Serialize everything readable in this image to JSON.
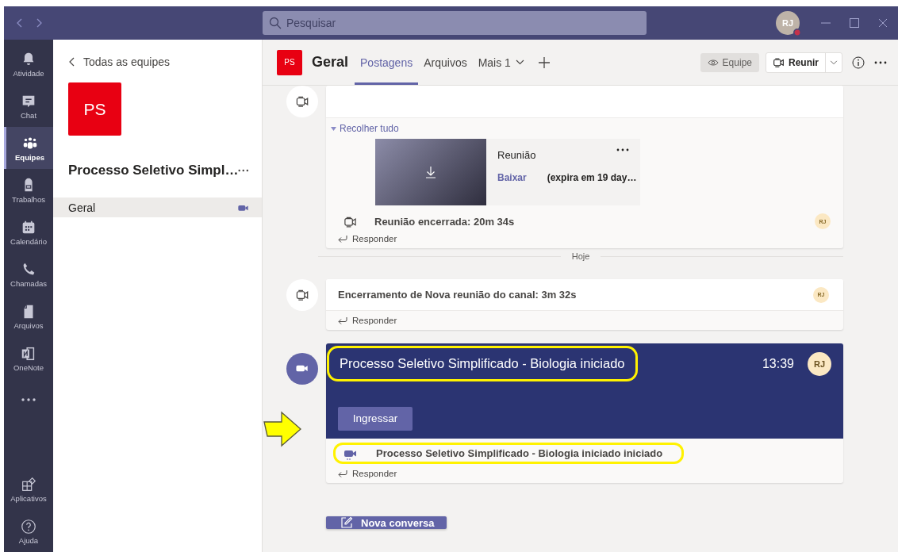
{
  "window": {
    "search_placeholder": "Pesquisar",
    "user_initials": "RJ"
  },
  "rail": [
    {
      "label": "Atividade",
      "kind": "bell",
      "selected": false
    },
    {
      "label": "Chat",
      "kind": "chat",
      "selected": false
    },
    {
      "label": "Equipes",
      "kind": "teams",
      "selected": true
    },
    {
      "label": "Trabalhos",
      "kind": "bag",
      "selected": false
    },
    {
      "label": "Calendário",
      "kind": "calendar",
      "selected": false
    },
    {
      "label": "Chamadas",
      "kind": "phone",
      "selected": false
    },
    {
      "label": "Arquivos",
      "kind": "file",
      "selected": false
    },
    {
      "label": "OneNote",
      "kind": "notebook",
      "selected": false
    }
  ],
  "rail_bottom": [
    {
      "label": "Aplicativos",
      "kind": "apps",
      "selected": false
    },
    {
      "label": "Ajuda",
      "kind": "help",
      "selected": false
    }
  ],
  "team_panel": {
    "back_label": "Todas as equipes",
    "team_initials": "PS",
    "team_name": "Processo Seletivo Simpl…",
    "channels": [
      {
        "name": "Geral",
        "selected": true,
        "meeting_active": true
      }
    ]
  },
  "channel_header": {
    "team_initials": "PS",
    "channel_name": "Geral",
    "tabs": [
      {
        "label": "Postagens",
        "selected": true,
        "dropdown": false
      },
      {
        "label": "Arquivos",
        "selected": false,
        "dropdown": false
      },
      {
        "label": "Mais 1",
        "selected": false,
        "dropdown": true
      }
    ],
    "team_button": "Equipe",
    "meet_button": "Reunir"
  },
  "messages": [
    {
      "kind": "recording",
      "collapse_label": "Recolher tudo",
      "attachment": {
        "title": "Reunião",
        "action": "Baixar",
        "expiry": "(expira em 19 day…"
      },
      "summary": "Reunião encerrada: 20m 34s",
      "author_initials": "RJ",
      "reply_label": "Responder"
    },
    {
      "kind": "divider",
      "label": "Hoje"
    },
    {
      "kind": "ended",
      "text": "Encerramento de Nova reunião do canal: 3m 32s",
      "author_initials": "RJ",
      "reply_label": "Responder"
    },
    {
      "kind": "live",
      "title": "Processo Seletivo Simplificado - Biologia iniciado",
      "title_highlighted": true,
      "time": "13:39",
      "author_initials": "RJ",
      "join_button": "Ingressar",
      "join_pointed": true,
      "subline": "Processo Seletivo Simplificado - Biologia iniciado iniciado",
      "subline_highlighted": true,
      "reply_label": "Responder"
    }
  ],
  "new_post_button": "Nova conversa"
}
